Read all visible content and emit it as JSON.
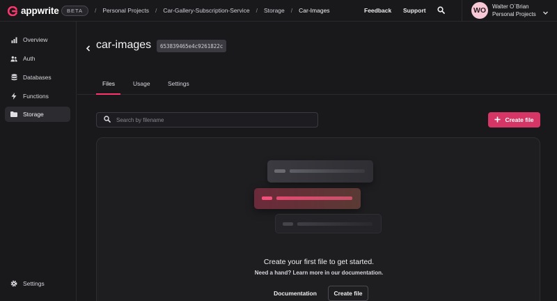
{
  "app": {
    "name": "appwrite",
    "badge": "BETA",
    "accent": "#fd366e"
  },
  "breadcrumbs": [
    "Personal Projects",
    "Car-Gallery-Subscription-Service",
    "Storage",
    "Car-Images"
  ],
  "topnav": {
    "feedback": "Feedback",
    "support": "Support",
    "search_icon": "search-icon"
  },
  "user": {
    "initials": "WO",
    "name": "Walter O`Brian",
    "org": "Personal Projects"
  },
  "sidebar": {
    "items": [
      {
        "label": "Overview",
        "icon": "bar-chart-icon"
      },
      {
        "label": "Auth",
        "icon": "users-icon"
      },
      {
        "label": "Databases",
        "icon": "database-icon"
      },
      {
        "label": "Functions",
        "icon": "lightning-icon"
      },
      {
        "label": "Storage",
        "icon": "folder-icon",
        "active": true
      }
    ],
    "settings": "Settings"
  },
  "bucket": {
    "title": "car-images",
    "id": "653839465e4c9261822c"
  },
  "tabs": [
    {
      "label": "Files",
      "active": true
    },
    {
      "label": "Usage"
    },
    {
      "label": "Settings"
    }
  ],
  "search": {
    "placeholder": "Search by filename"
  },
  "actions": {
    "create_file": "Create file"
  },
  "empty": {
    "title": "Create your first file to get started.",
    "subtitle": "Need a hand? Learn more in our documentation.",
    "documentation": "Documentation",
    "create_file": "Create file"
  }
}
